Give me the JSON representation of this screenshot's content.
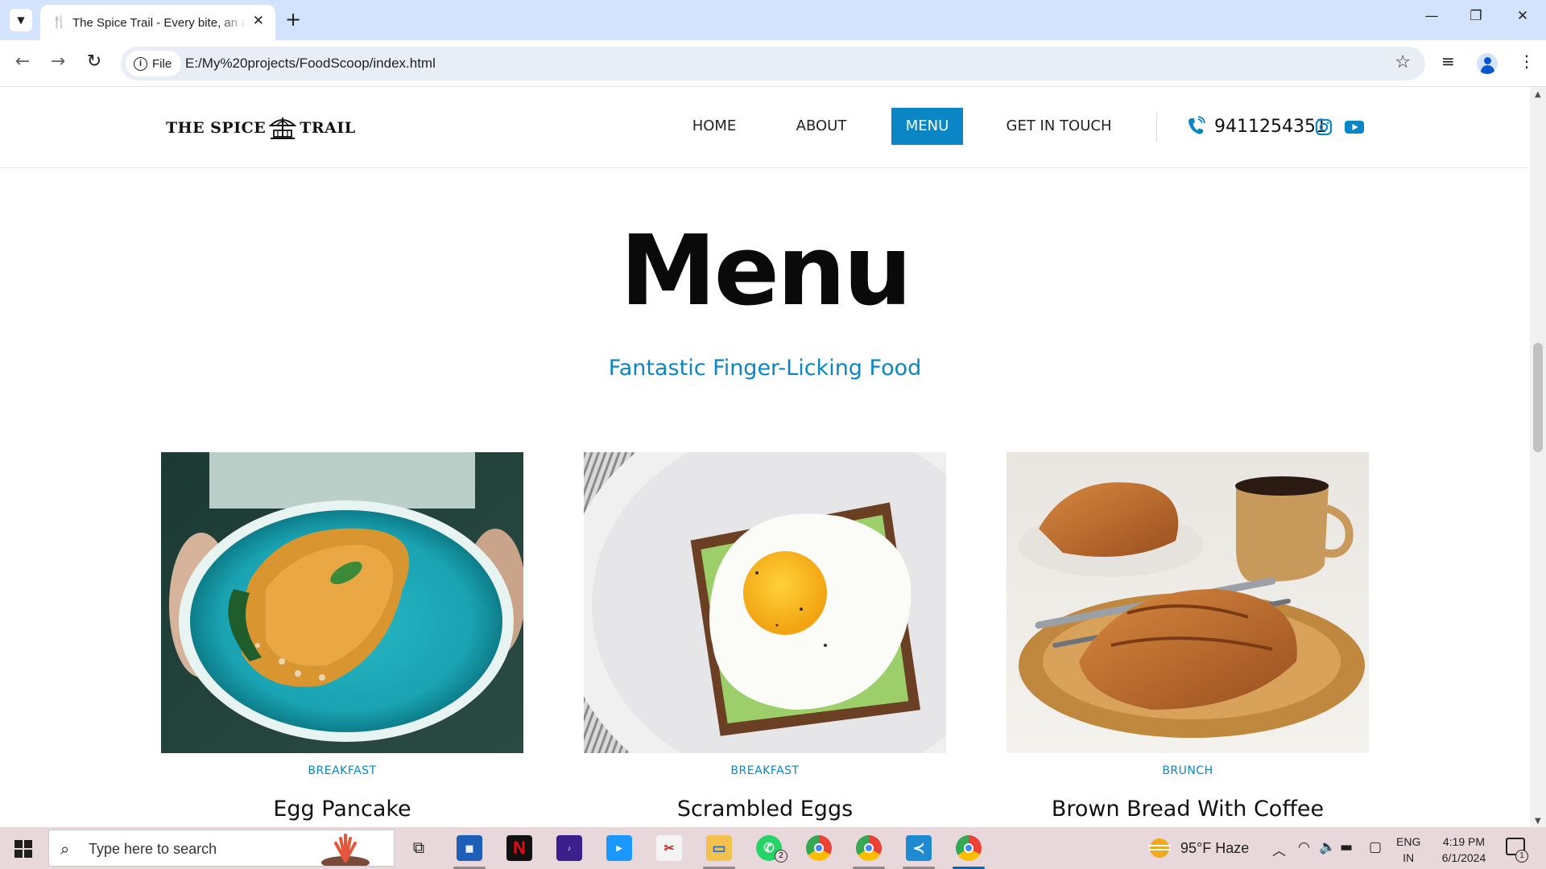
{
  "browser": {
    "tab_title": "The Spice Trail - Every bite, an adventure",
    "tab_close": "✕",
    "new_tab": "+",
    "file_chip": "File",
    "url": "E:/My%20projects/FoodScoop/index.html",
    "window_controls": {
      "minimize": "—",
      "restore": "❐",
      "close": "✕"
    }
  },
  "site": {
    "logo_left": "THE SPICE",
    "logo_right": "TRAIL",
    "nav": [
      {
        "label": "HOME",
        "active": false
      },
      {
        "label": "ABOUT",
        "active": false
      },
      {
        "label": "MENU",
        "active": true
      },
      {
        "label": "GET IN TOUCH",
        "active": false
      }
    ],
    "phone": "9411254351",
    "accent_color": "#0a86c4",
    "social_icons": [
      "instagram-icon",
      "youtube-icon"
    ]
  },
  "section": {
    "title": "Menu",
    "subtitle": "Fantastic Finger-Licking Food"
  },
  "menu_items": [
    {
      "category": "BREAKFAST",
      "name": "Egg Pancake",
      "image": "omelette-on-turquoise-plate"
    },
    {
      "category": "BREAKFAST",
      "name": "Scrambled Eggs",
      "image": "fried-egg-on-avocado-toast"
    },
    {
      "category": "BRUNCH",
      "name": "Brown Bread With Coffee",
      "image": "croissants-with-coffee-cup"
    }
  ],
  "taskbar": {
    "search_placeholder": "Type here to search",
    "whatsapp_badge": "2",
    "weather": "95°F  Haze",
    "lang_top": "ENG",
    "lang_bottom": "IN",
    "time": "4:19 PM",
    "date": "6/1/2024",
    "notification_count": "1"
  }
}
